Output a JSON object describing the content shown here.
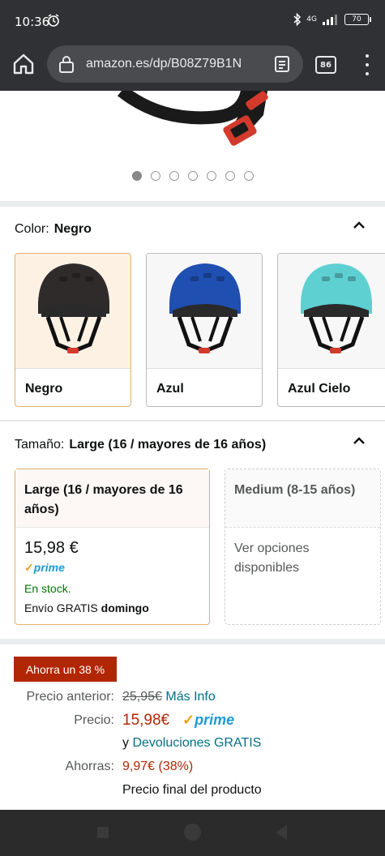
{
  "status": {
    "time": "10:36",
    "battery": "70",
    "network": "4G"
  },
  "browser": {
    "url": "amazon.es/dp/B08Z79B1N",
    "tab_count": "86"
  },
  "gallery": {
    "image_count": 7,
    "active_index": 0
  },
  "color": {
    "label": "Color:",
    "selected": "Negro",
    "options": [
      {
        "name": "Negro",
        "color": "#2e2b2a"
      },
      {
        "name": "Azul",
        "color": "#1f4fb0"
      },
      {
        "name": "Azul Cielo",
        "color": "#5fd0d2"
      }
    ]
  },
  "size": {
    "label": "Tamaño:",
    "selected": "Large (16 / mayores de 16 años)",
    "selected_card": {
      "title": "Large (16 / mayores de 16 años)",
      "price": "15,98 €",
      "prime": "prime",
      "stock": "En stock.",
      "shipping_prefix": "Envío GRATIS",
      "shipping_day": "domingo"
    },
    "other_card": {
      "title": "Medium (8-15 años)",
      "note": "Ver opciones disponibles"
    }
  },
  "pricing": {
    "badge": "Ahorra un 38 %",
    "previous_label": "Precio anterior:",
    "previous_value": "25,95€",
    "more_info": "Más Info",
    "price_label": "Precio:",
    "price_value": "15,98€",
    "prime": "prime",
    "returns_prefix": "y",
    "returns_link": "Devoluciones GRATIS",
    "savings_label": "Ahorras:",
    "savings_value": "9,97€ (38%)",
    "final_note": "Precio final del producto"
  }
}
